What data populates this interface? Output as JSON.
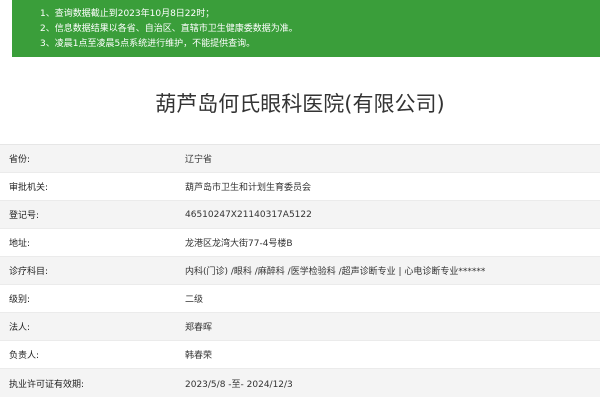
{
  "notice": {
    "lines": [
      "1、查询数据截止到2023年10月8日22时；",
      "2、信息数据结果以各省、自治区、直辖市卫生健康委数据为准。",
      "3、凌晨1点至凌晨5点系统进行维护，不能提供查询。"
    ]
  },
  "title": "葫芦岛何氏眼科医院(有限公司)",
  "rows": [
    {
      "label": "省份:",
      "value": "辽宁省"
    },
    {
      "label": "审批机关:",
      "value": "葫芦岛市卫生和计划生育委员会"
    },
    {
      "label": "登记号:",
      "value": "46510247X21140317A5122"
    },
    {
      "label": "地址:",
      "value": "龙港区龙湾大街77-4号楼B"
    },
    {
      "label": "诊疗科目:",
      "value": "内科(门诊) /眼科 /麻醉科 /医学检验科 /超声诊断专业 | 心电诊断专业******"
    },
    {
      "label": "级别:",
      "value": "二级"
    },
    {
      "label": "法人:",
      "value": "郑春晖"
    },
    {
      "label": "负责人:",
      "value": "韩春荣"
    },
    {
      "label": "执业许可证有效期:",
      "value": "2023/5/8 -至- 2024/12/3"
    }
  ]
}
